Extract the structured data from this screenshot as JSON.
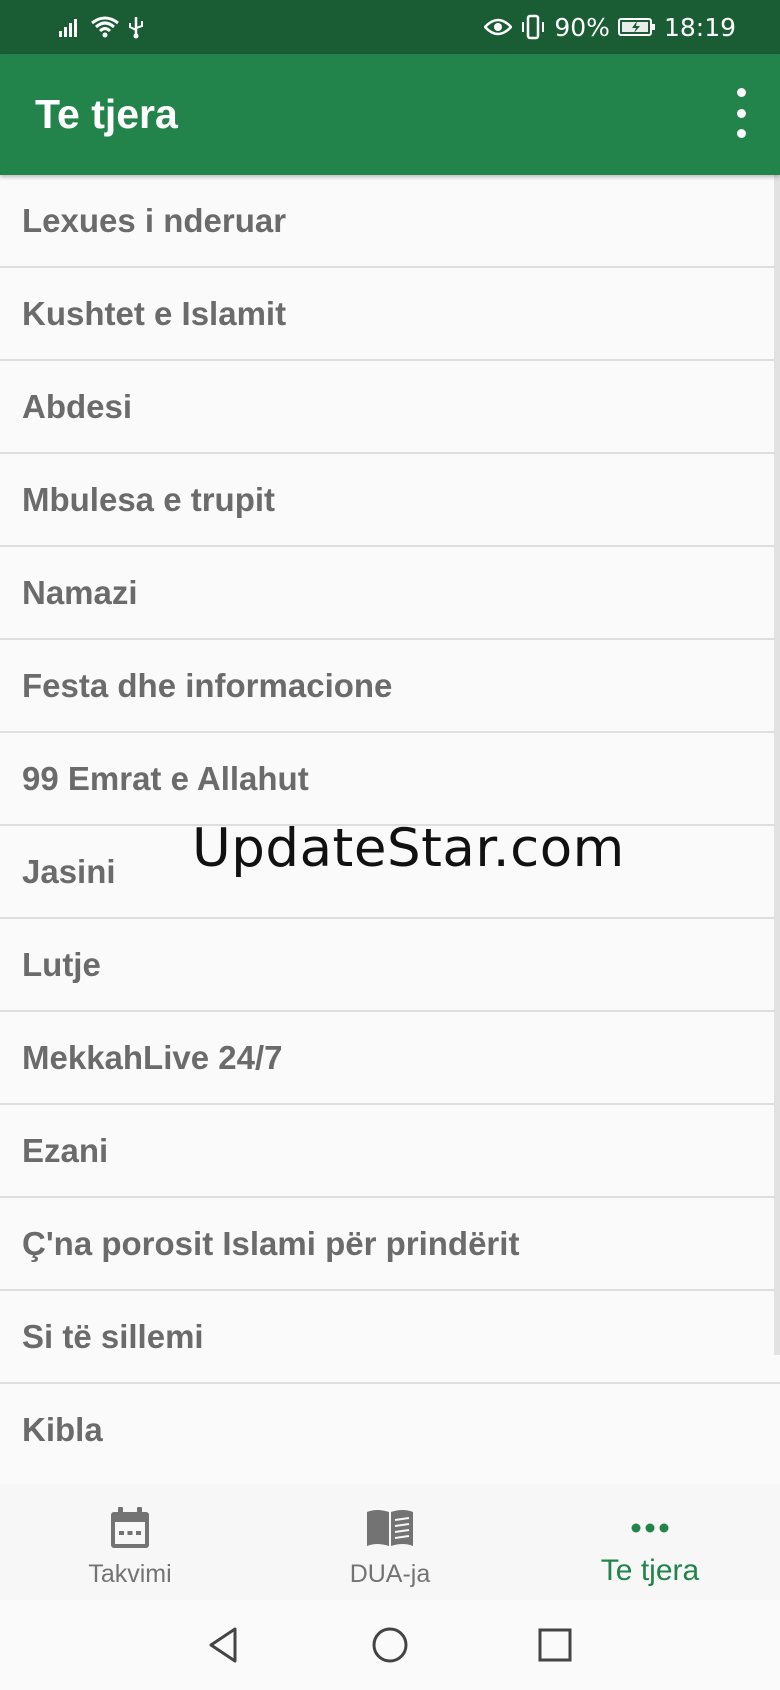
{
  "status_bar": {
    "battery_percent": "90%",
    "time": "18:19",
    "icons": [
      "signal-icon",
      "wifi-icon",
      "usb-icon",
      "eye-icon",
      "vibrate-icon",
      "battery-icon"
    ]
  },
  "app_bar": {
    "title": "Te tjera",
    "menu_icon": "more-vert-icon"
  },
  "menu_items": [
    {
      "label": "Lexues i nderuar"
    },
    {
      "label": "Kushtet e Islamit"
    },
    {
      "label": "Abdesi"
    },
    {
      "label": "Mbulesa e trupit"
    },
    {
      "label": "Namazi"
    },
    {
      "label": "Festa dhe informacione"
    },
    {
      "label": "99 Emrat e Allahut"
    },
    {
      "label": "Jasini"
    },
    {
      "label": "Lutje"
    },
    {
      "label": "MekkahLive 24/7"
    },
    {
      "label": "Ezani"
    },
    {
      "label": "Ç'na porosit Islami për prindërit"
    },
    {
      "label": "Si të sillemi"
    },
    {
      "label": "Kibla"
    }
  ],
  "watermark": "UpdateStar.com",
  "bottom_nav": {
    "items": [
      {
        "label": "Takvimi",
        "icon": "calendar-icon",
        "active": false
      },
      {
        "label": "DUA-ja",
        "icon": "book-icon",
        "active": false
      },
      {
        "label": "Te tjera",
        "icon": "more-horiz-icon",
        "active": true
      }
    ]
  },
  "system_nav": [
    "back-icon",
    "home-icon",
    "recents-icon"
  ],
  "colors": {
    "status_bar": "#1a5c34",
    "app_bar": "#22844a",
    "accent": "#22844a",
    "list_text": "#6b6b6b",
    "nav_inactive": "#737373"
  }
}
